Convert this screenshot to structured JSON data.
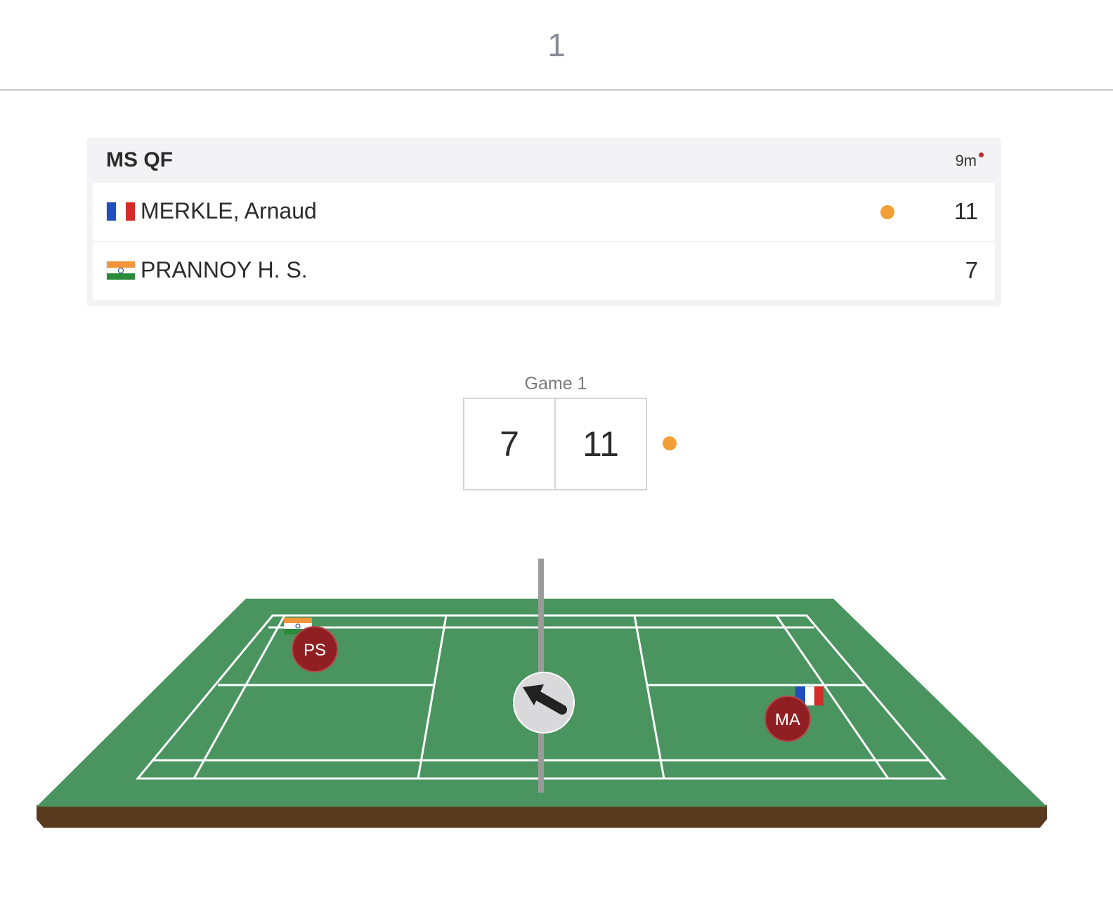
{
  "page": {
    "number": "1"
  },
  "match": {
    "round": "MS QF",
    "duration": "9m",
    "players": [
      {
        "name": "MERKLE, Arnaud",
        "country_flag": "france-flag",
        "score": "11",
        "serving": true
      },
      {
        "name": "PRANNOY H. S.",
        "country_flag": "india-flag",
        "score": "7",
        "serving": false
      }
    ]
  },
  "game": {
    "label": "Game 1",
    "score_left": "7",
    "score_right": "11",
    "serving_side": "right"
  },
  "court": {
    "left_player": {
      "initials": "PS",
      "flag": "india-flag"
    },
    "right_player": {
      "initials": "MA",
      "flag": "france-flag"
    },
    "shuttle_direction_icon": "arrow-up-left-icon"
  },
  "colors": {
    "court_green": "#4a9460",
    "court_base": "#5a3a1e",
    "player_badge": "#8f1f22",
    "serve_indicator": "#f2a035",
    "live_indicator": "#c62828"
  }
}
